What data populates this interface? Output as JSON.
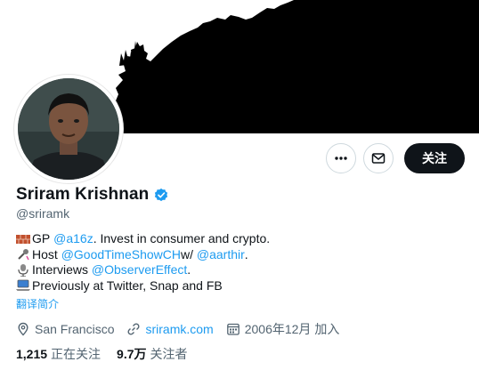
{
  "profile": {
    "display_name": "Sriram Krishnan",
    "handle": "@sriramk",
    "verified_icon": "verified-badge-icon"
  },
  "actions": {
    "more_icon": "more-icon",
    "message_icon": "mail-icon",
    "follow_label": "关注"
  },
  "bio": {
    "line1": {
      "emoji": "brick-icon",
      "prefix": "GP ",
      "mention": "@a16z",
      "suffix": ". Invest in consumer and crypto."
    },
    "line2": {
      "emoji": "microphone-icon",
      "prefix": "Host ",
      "mention": "@GoodTimeShowCH",
      "middle": " w/ ",
      "mention2": "@aarthir",
      "suffix": "."
    },
    "line3": {
      "emoji": "studio-microphone-icon",
      "prefix": "Interviews ",
      "mention": "@ObserverEffect",
      "suffix": "."
    },
    "line4": {
      "emoji": "laptop-icon",
      "text": "Previously at Twitter, Snap and FB"
    },
    "translate_label": "翻译简介"
  },
  "meta": {
    "location": "San Francisco",
    "website": "sriramk.com",
    "joined": "2006年12月 加入"
  },
  "stats": {
    "following_count": "1,215",
    "following_label": "正在关注",
    "followers_count": "9.7万",
    "followers_label": "关注者"
  },
  "colors": {
    "accent": "#1d9bf0",
    "text": "#0f1419",
    "secondary": "#536471",
    "button_dark": "#0f1419"
  }
}
